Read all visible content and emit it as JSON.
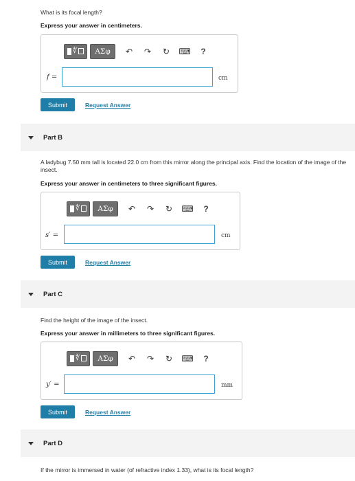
{
  "partA": {
    "question": "What is its focal length?",
    "instruction": "Express your answer in centimeters.",
    "variable": "f =",
    "unit": "cm",
    "submit": "Submit",
    "request": "Request Answer"
  },
  "toolbar": {
    "symbols": "ΑΣφ",
    "undo": "↶",
    "redo": "↷",
    "reset": "↻",
    "keyboard": "⌨",
    "help": "?"
  },
  "partB": {
    "header": "Part B",
    "question": "A ladybug 7.50 mm tall is located 22.0 cm from this mirror along the principal axis. Find the location of the image of the insect.",
    "instruction": "Express your answer in centimeters to three significant figures.",
    "variable": "s′ =",
    "unit": "cm",
    "submit": "Submit",
    "request": "Request Answer"
  },
  "partC": {
    "header": "Part C",
    "question": "Find the height of the image of the insect.",
    "instruction": "Express your answer in millimeters to three significant figures.",
    "variable": "y′ =",
    "unit": "mm",
    "submit": "Submit",
    "request": "Request Answer"
  },
  "partD": {
    "header": "Part D",
    "question": "If the mirror is immersed in water (of refractive index 1.33), what is its focal length?"
  }
}
